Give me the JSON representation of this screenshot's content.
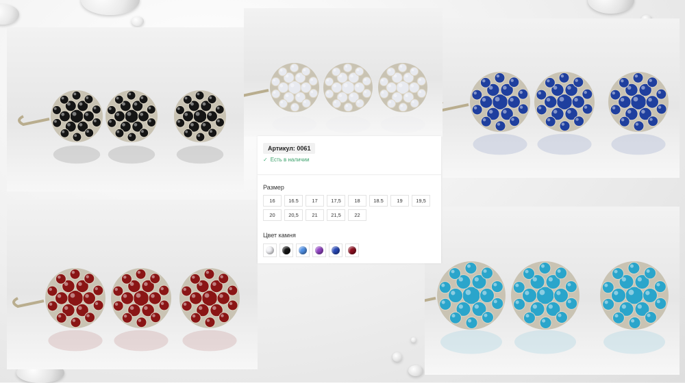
{
  "product": {
    "sku_label": "Артикул: 0061",
    "stock_text": "Есть в наличии",
    "size_heading": "Размер",
    "sizes": [
      "16",
      "16.5",
      "17",
      "17,5",
      "18",
      "18.5",
      "19",
      "19,5",
      "20",
      "20,5",
      "21",
      "21,5",
      "22"
    ],
    "color_heading": "Цвет камня",
    "stone_colors": [
      {
        "name": "white",
        "hex": "#f3f3f7"
      },
      {
        "name": "black",
        "hex": "#151515"
      },
      {
        "name": "light-blue",
        "hex": "#4f8fe4"
      },
      {
        "name": "purple",
        "hex": "#9245c4"
      },
      {
        "name": "blue",
        "hex": "#2848b6"
      },
      {
        "name": "red",
        "hex": "#8c1020"
      }
    ]
  },
  "photos": [
    {
      "name": "photo-black-earrings",
      "stone": "#151515"
    },
    {
      "name": "photo-white-earrings",
      "stone": "#e8eaf0"
    },
    {
      "name": "photo-blue-earrings",
      "stone": "#1f3f9e"
    },
    {
      "name": "photo-red-earrings",
      "stone": "#8a1515"
    },
    {
      "name": "photo-teal-earrings",
      "stone": "#2aa5cb"
    }
  ]
}
